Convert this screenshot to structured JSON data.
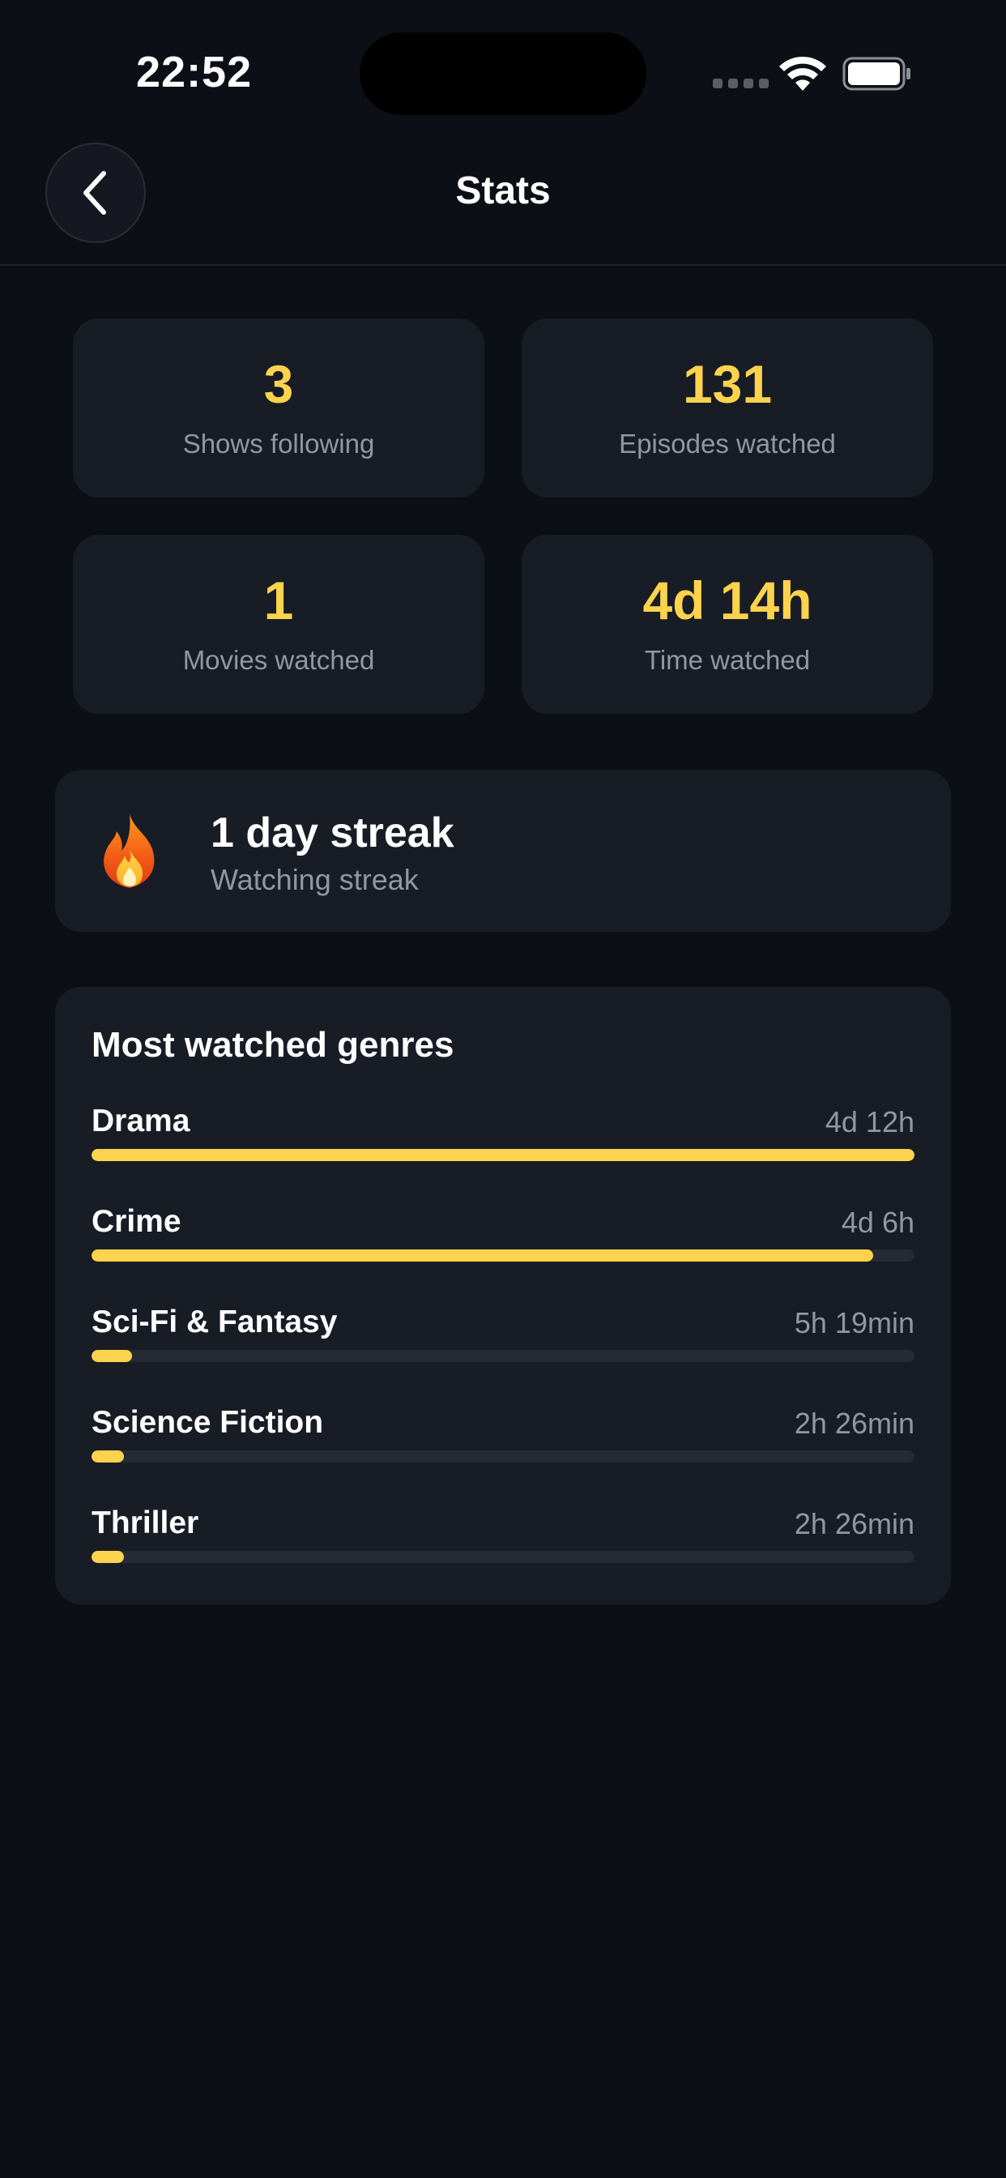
{
  "status_bar": {
    "time": "22:52"
  },
  "nav": {
    "title": "Stats",
    "back_icon": "chevron-left-icon"
  },
  "stats": [
    {
      "value": "3",
      "label": "Shows following"
    },
    {
      "value": "131",
      "label": "Episodes watched"
    },
    {
      "value": "1",
      "label": "Movies watched"
    },
    {
      "value": "4d 14h",
      "label": "Time watched"
    }
  ],
  "streak": {
    "icon": "fire-icon",
    "title": "1 day streak",
    "subtitle": "Watching streak"
  },
  "genres": {
    "title": "Most watched genres",
    "items": [
      {
        "name": "Drama",
        "time": "4d 12h",
        "fraction": 1.0
      },
      {
        "name": "Crime",
        "time": "4d 6h",
        "fraction": 0.95
      },
      {
        "name": "Sci-Fi & Fantasy",
        "time": "5h 19min",
        "fraction": 0.049
      },
      {
        "name": "Science Fiction",
        "time": "2h 26min",
        "fraction": 0.039
      },
      {
        "name": "Thriller",
        "time": "2h 26min",
        "fraction": 0.039
      }
    ]
  },
  "colors": {
    "background": "#0c0f16",
    "card": "#181c25",
    "accent": "#fcd34d",
    "muted_text": "#9197a3",
    "track": "#262a33"
  }
}
